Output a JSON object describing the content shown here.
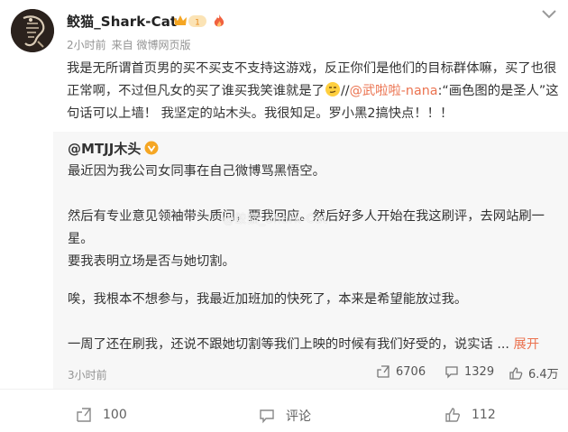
{
  "post": {
    "username": "鲛猫_Shark-Cat",
    "time": "2小时前",
    "source": "来自 微博网页版",
    "text_part1": "我是无所谓首页男的买不买支不支持这游戏，反正你们是他们的目标群体嘛，买了也很正常啊，不过但凡女的买了谁买我笑谁就是了",
    "text_sep": "//",
    "mention": "@武啦啦-nana",
    "text_part2": ":“画色图的是圣人”这句话可以上墙！ 我坚定的站木头。我很知足。罗小黑2搞快点！！！"
  },
  "repost": {
    "username": "@MTJJ木头",
    "line1": "最近因为我公司女同事在自己微博骂黑悟空。",
    "line2": "然后有专业意见领袖带头质问，要我回应。然后好多人开始在我这刷评，去网站刷一星。",
    "line3": "要我表明立场是否与她切割。",
    "line4": "唉，我根本不想参与，我最近加班加的快死了，本来是希望能放过我。",
    "line5": "一周了还在刷我，还说不跟她切割等我们上映的时候有我们好受的，说实话 ...",
    "expand": "展开",
    "watermark": "@鲛猫_Shark-Cat",
    "time": "3小时前",
    "reposts": "6706",
    "comments": "1329",
    "likes": "6.4万"
  },
  "actions": {
    "repost": "100",
    "comment": "评论",
    "like": "112"
  },
  "icons": [
    "avatar-skeleton-icon",
    "chevron-down-icon",
    "vip-crown-badge-icon",
    "flame-icon",
    "smirk-emoji-icon",
    "gold-verified-icon",
    "repost-icon",
    "comment-icon",
    "like-icon"
  ],
  "colors": {
    "accent": "#eb7350",
    "meta": "#939393",
    "repost_bg": "#f7f7f7",
    "gold": "#f5a623"
  }
}
